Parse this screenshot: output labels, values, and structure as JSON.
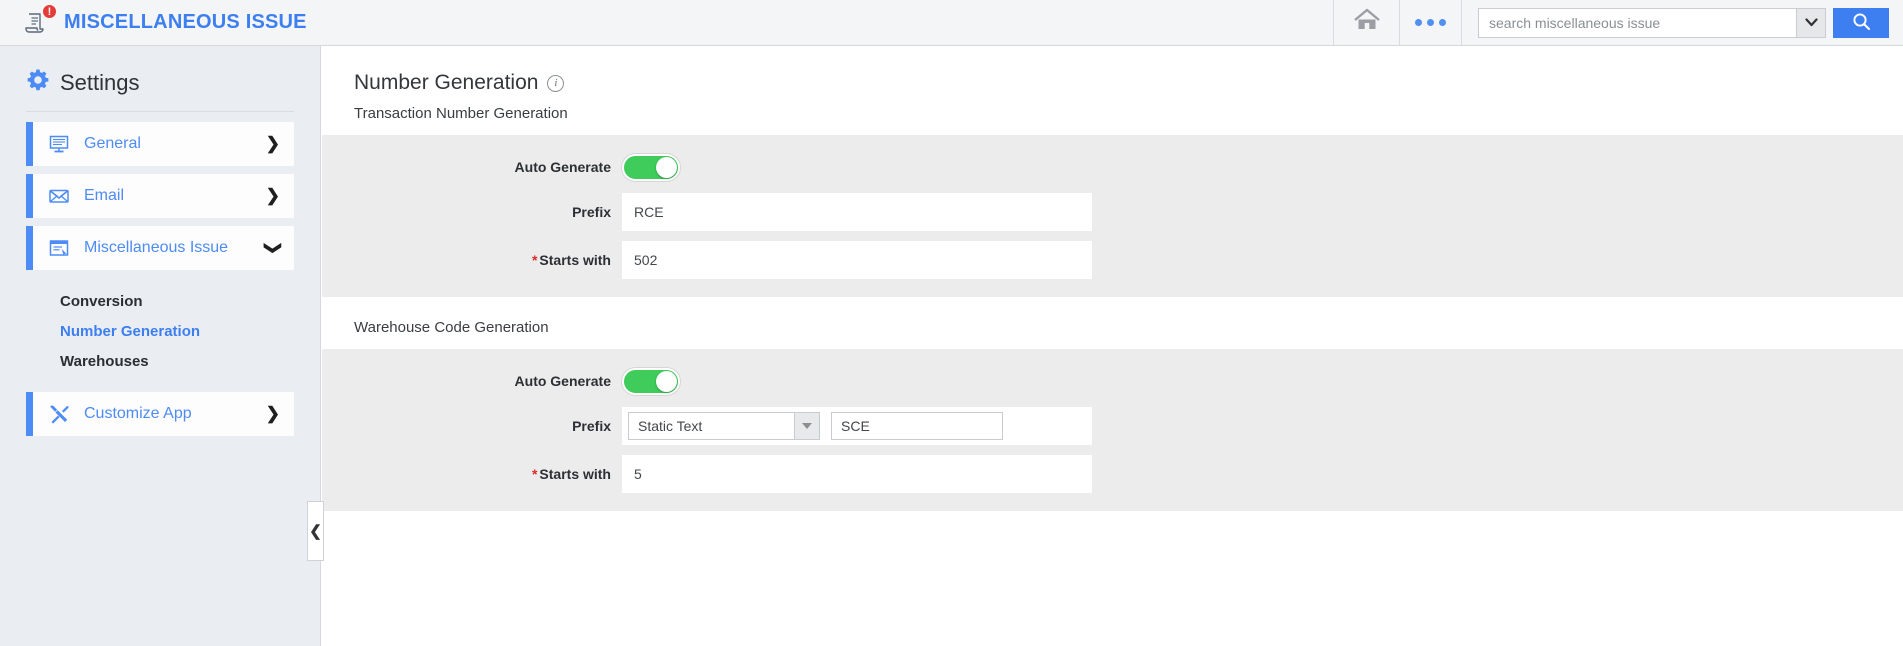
{
  "topbar": {
    "app_icon": "document-icon",
    "badge_count": "!",
    "app_title": "MISCELLANEOUS ISSUE",
    "home_icon": "home-icon",
    "more_icon": "more-options-icon",
    "search_placeholder": "search miscellaneous issue",
    "search_value": "",
    "search_dropdown_icon": "chevron-down-icon",
    "search_button_icon": "search-icon"
  },
  "sidebar": {
    "title": "Settings",
    "gear_icon": "gear-icon",
    "items": [
      {
        "label": "General",
        "icon": "monitor-icon",
        "chevron": "❯",
        "expanded": false
      },
      {
        "label": "Email",
        "icon": "envelope-icon",
        "chevron": "❯",
        "expanded": false
      },
      {
        "label": "Miscellaneous Issue",
        "icon": "form-icon",
        "chevron": "❯",
        "expanded": true
      }
    ],
    "sub_items": [
      {
        "label": "Conversion",
        "active": false
      },
      {
        "label": "Number Generation",
        "active": true
      },
      {
        "label": "Warehouses",
        "active": false
      }
    ],
    "customize": {
      "label": "Customize App",
      "icon": "tools-icon",
      "chevron": "❯"
    },
    "collapse_icon": "chevron-left-icon"
  },
  "main": {
    "page_title": "Number Generation",
    "info_icon": "info-icon",
    "sections": [
      {
        "heading": "Transaction Number Generation",
        "auto_generate_label": "Auto Generate",
        "auto_generate_on": true,
        "prefix_label": "Prefix",
        "prefix_value": "RCE",
        "starts_with_label": "Starts with",
        "starts_with_value": "502",
        "required_mark": "*",
        "has_prefix_select": false
      },
      {
        "heading": "Warehouse Code Generation",
        "auto_generate_label": "Auto Generate",
        "auto_generate_on": true,
        "prefix_label": "Prefix",
        "prefix_select_value": "Static Text",
        "prefix_value": "SCE",
        "starts_with_label": "Starts with",
        "starts_with_value": "5",
        "required_mark": "*",
        "has_prefix_select": true
      }
    ]
  },
  "colors": {
    "accent_blue": "#3d7ff0",
    "nav_blue": "#4d8bf5",
    "toggle_green": "#3fcc5a",
    "badge_red": "#e23b38",
    "panel_gray": "#ececec",
    "sidebar_bg": "#eaeef3"
  }
}
